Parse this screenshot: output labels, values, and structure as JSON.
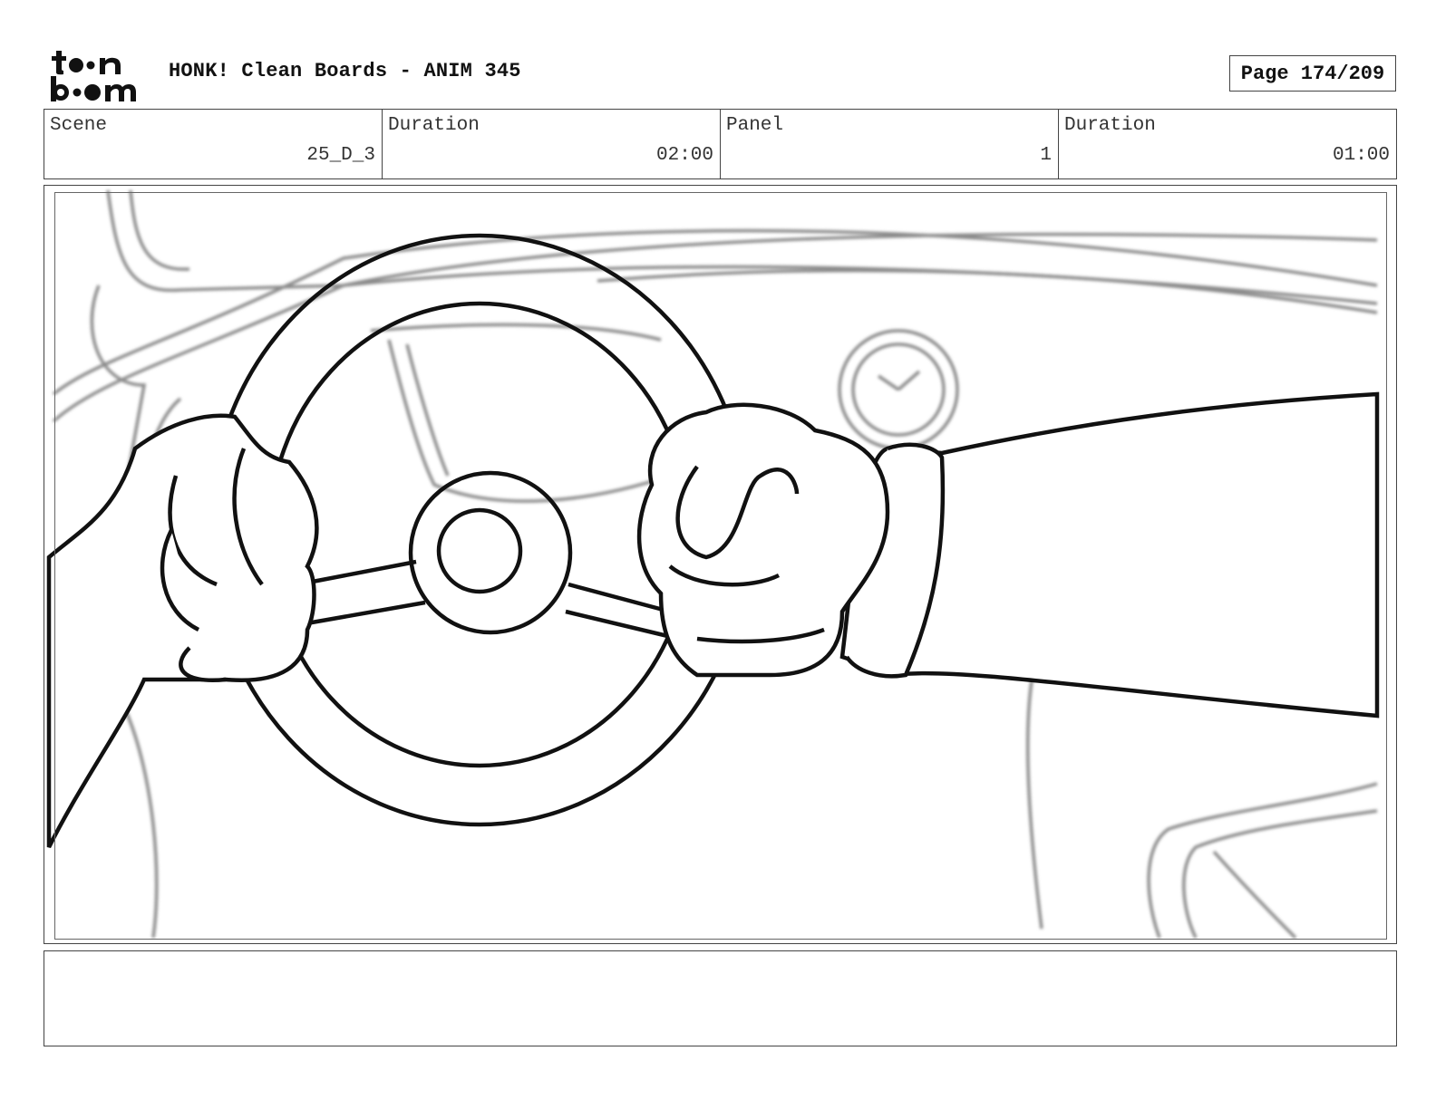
{
  "header": {
    "logo_text": "toon boom",
    "title": "HONK! Clean Boards - ANIM 345",
    "page": "Page 174/209"
  },
  "info": {
    "scene_label": "Scene",
    "scene_value": "25_D_3",
    "scene_duration_label": "Duration",
    "scene_duration_value": "02:00",
    "panel_label": "Panel",
    "panel_value": "1",
    "panel_duration_label": "Duration",
    "panel_duration_value": "01:00"
  },
  "panel": {
    "image_description_name": "steering-wheel-drawing"
  },
  "notes": {
    "text": ""
  }
}
